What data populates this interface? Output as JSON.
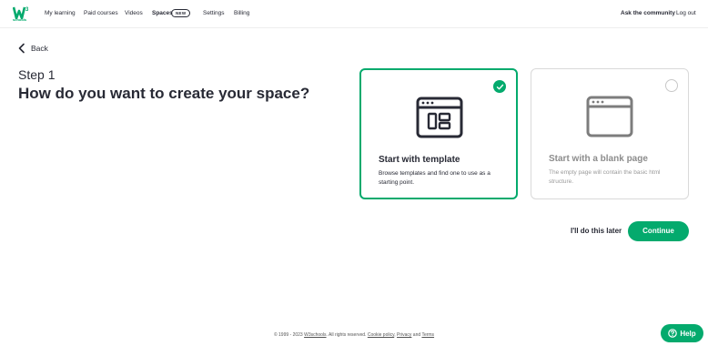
{
  "logo": {
    "alt": "w3schools logo",
    "text": "schools"
  },
  "nav": {
    "items": [
      "My learning",
      "Paid courses",
      "Videos",
      "Spaces",
      "Settings",
      "Billing"
    ],
    "spaces_badge": "NEW",
    "community": "Ask the community",
    "logout": "Log out"
  },
  "back_label": "Back",
  "step": "Step 1",
  "question": "How do you want to create your space?",
  "options": [
    {
      "title": "Start with template",
      "desc": "Browse templates and find one to use as a starting point.",
      "selected": true
    },
    {
      "title": "Start with a blank page",
      "desc": "The empty page will contain the basic html structure.",
      "selected": false
    }
  ],
  "actions": {
    "later": "I'll do this later",
    "continue": "Continue"
  },
  "footer": {
    "text_pre": "© 1999 - 2023 ",
    "brand": "W3schools",
    "text_mid": ". All rights reserved. ",
    "cookie": "Cookie policy",
    "comma": ", ",
    "privacy": "Privacy",
    "and": " and ",
    "terms": "Terms"
  },
  "help": "Help",
  "colors": {
    "accent": "#04aa6d",
    "text": "#282a35"
  }
}
